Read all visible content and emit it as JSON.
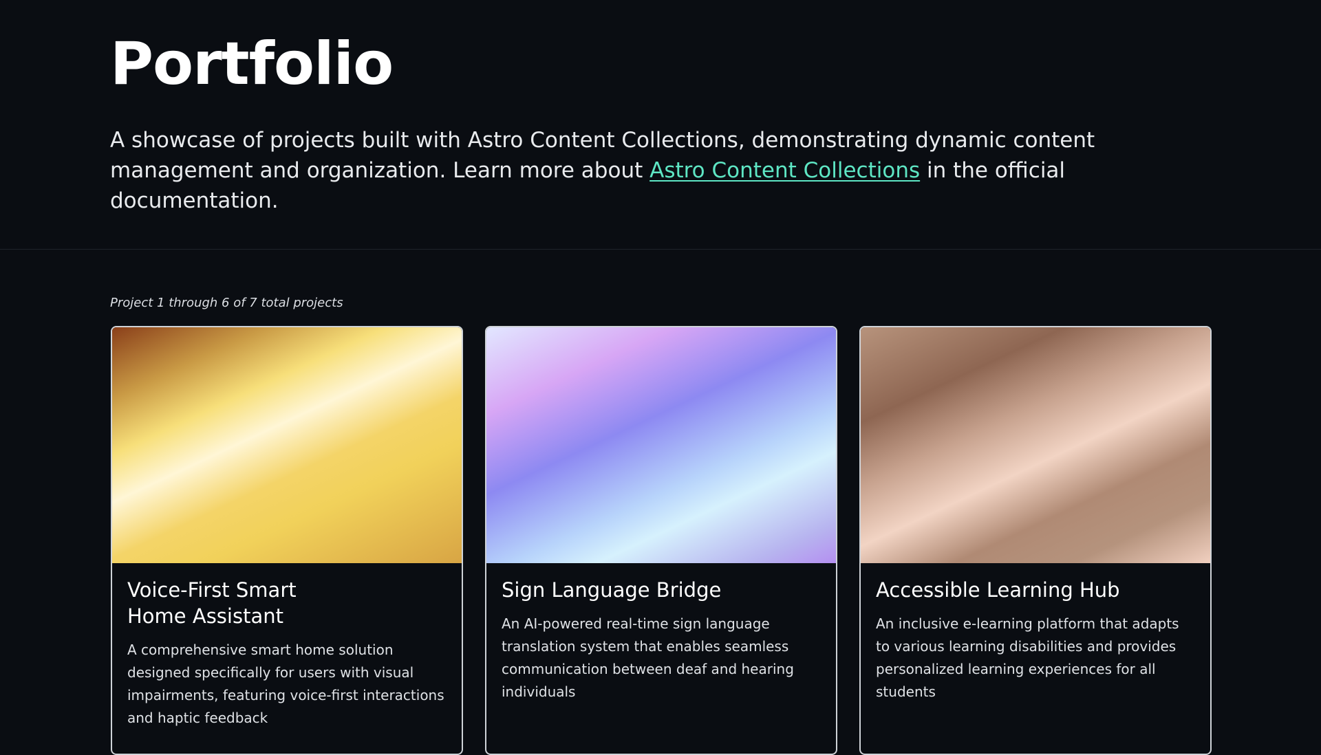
{
  "header": {
    "title": "Portfolio",
    "intro_before": "A showcase of projects built with Astro Content Collections, demonstrating dynamic content management and organization. Learn more about ",
    "intro_link": "Astro Content Collections",
    "intro_after": " in the official documentation."
  },
  "listing": {
    "count_text": "Project 1 through 6 of 7 total projects",
    "projects": [
      {
        "title": "Voice-First Smart Home Assistant",
        "description": "A comprehensive smart home solution designed specifically for users with visual impairments, featuring voice-first interactions and haptic feedback"
      },
      {
        "title": "Sign Language Bridge",
        "description": "An AI-powered real-time sign language translation system that enables seamless communication between deaf and hearing individuals"
      },
      {
        "title": "Accessible Learning Hub",
        "description": "An inclusive e-learning platform that adapts to various learning disabilities and provides personalized learning experiences for all students"
      }
    ]
  },
  "colors": {
    "background": "#0a0d12",
    "link": "#5ee6c4",
    "card_border": "#cfd3d8"
  }
}
